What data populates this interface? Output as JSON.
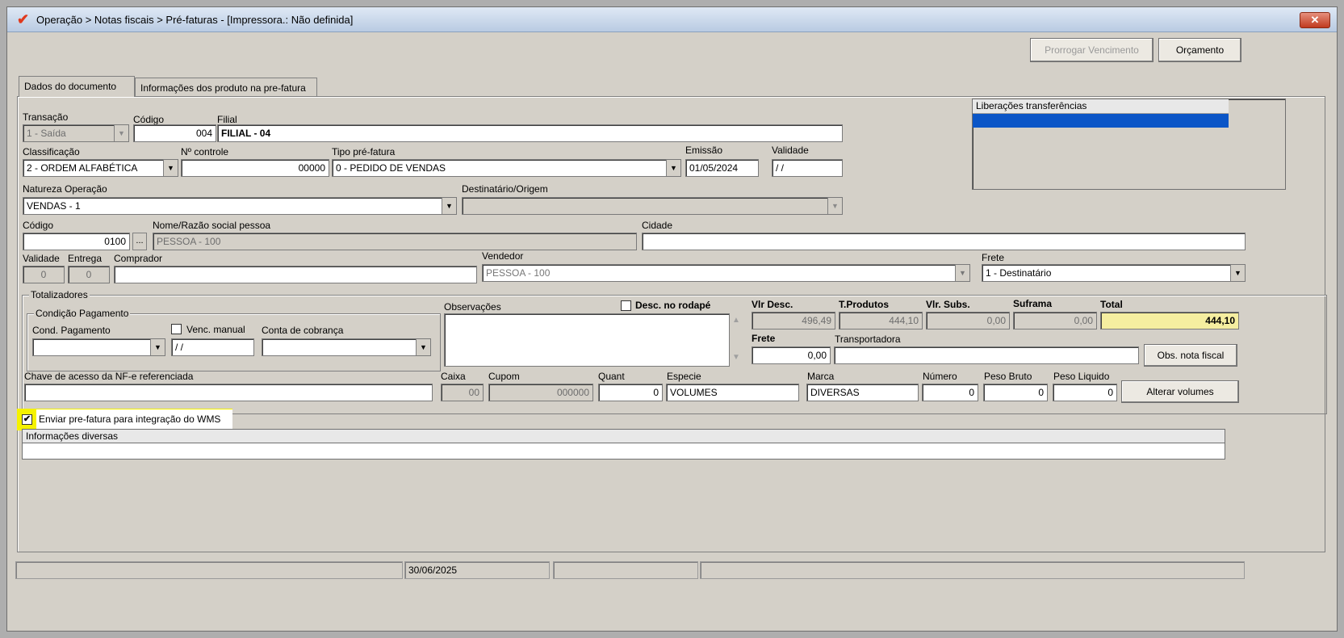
{
  "window": {
    "title": "Operação > Notas fiscais > Pré-faturas - [Impressora.: Não definida]",
    "close_label": "✕"
  },
  "toolbar": {
    "prorrogar_label": "Prorrogar Vencimento",
    "orcamento_label": "Orçamento"
  },
  "tabs": [
    {
      "label": "Dados do documento"
    },
    {
      "label": "Informações dos produto na pre-fatura"
    }
  ],
  "doc": {
    "transacao_label": "Transação",
    "transacao_value": "1 - Saída",
    "codigo_label": "Código",
    "codigo_value": "004",
    "filial_label": "Filial",
    "filial_value": "FILIAL - 04",
    "classificacao_label": "Classificação",
    "classificacao_value": "2 - ORDEM ALFABÉTICA",
    "ncontrole_label": "Nº controle",
    "ncontrole_value": "00000",
    "tipo_label": "Tipo pré-fatura",
    "tipo_value": "0  - PEDIDO DE VENDAS",
    "emissao_label": "Emissão",
    "emissao_value": "01/05/2024",
    "validade_label": "Validade",
    "validade_value": " / /",
    "natureza_label": "Natureza  Operação",
    "natureza_value": "VENDAS - 1",
    "destinatario_label": "Destinatário/Origem",
    "destinatario_value": "",
    "pessoa_codigo_label": "Código",
    "pessoa_codigo_value": "0100",
    "ellipsis": "...",
    "nome_label": "Nome/Razão social pessoa",
    "nome_value": "PESSOA - 100",
    "cidade_label": "Cidade",
    "cidade_value": "",
    "validade2_label": "Validade",
    "validade2_value": "0",
    "entrega_label": "Entrega",
    "entrega_value": "0",
    "comprador_label": "Comprador",
    "comprador_value": "",
    "vendedor_label": "Vendedor",
    "vendedor_value": "PESSOA - 100",
    "frete_label": "Frete",
    "frete_value": "1 - Destinatário"
  },
  "liberacoes": {
    "header": "Liberações transferências"
  },
  "totalizadores": {
    "title": "Totalizadores",
    "condicao": {
      "title": "Condição Pagamento",
      "cond_label": "Cond. Pagamento",
      "cond_value": "",
      "venc_label": "Venc. manual",
      "venc_value": " / /",
      "conta_label": "Conta de cobrança",
      "conta_value": ""
    },
    "observacoes_label": "Observações",
    "observacoes_value": "",
    "desc_rodape_label": "Desc. no rodapé",
    "vlr_desc_label": "Vlr Desc.",
    "vlr_desc_value": "496,49",
    "t_produtos_label": "T.Produtos",
    "t_produtos_value": "444,10",
    "vlr_subs_label": "Vlr. Subs.",
    "vlr_subs_value": "0,00",
    "suframa_label": "Suframa",
    "suframa_value": "0,00",
    "total_label": "Total",
    "total_value": "444,10",
    "frete_label": "Frete",
    "frete_value": "0,00",
    "transportadora_label": "Transportadora",
    "transportadora_value": "",
    "obs_nota_label": "Obs. nota fiscal",
    "chave_label": "Chave de acesso da NF-e referenciada",
    "chave_value": "",
    "caixa_label": "Caixa",
    "caixa_value": "00",
    "cupom_label": "Cupom",
    "cupom_value": "000000",
    "quant_label": "Quant",
    "quant_value": "0",
    "especie_label": "Especie",
    "especie_value": "VOLUMES",
    "marca_label": "Marca",
    "marca_value": "DIVERSAS",
    "numero_label": "Número",
    "numero_value": "0",
    "peso_bruto_label": "Peso Bruto",
    "peso_bruto_value": "0",
    "peso_liquido_label": "Peso Liquido",
    "peso_liquido_value": "0",
    "alterar_label": "Alterar volumes"
  },
  "wms": {
    "label": "Enviar pre-fatura para integração do WMS",
    "checked": true,
    "check_glyph": "✔"
  },
  "info": {
    "header": "Informações diversas"
  },
  "statusbar": {
    "date": "30/06/2025"
  },
  "colors": {
    "highlight_yellow": "#f5f200",
    "selection_blue": "#0a55c7",
    "total_bg": "#f5eea0"
  }
}
